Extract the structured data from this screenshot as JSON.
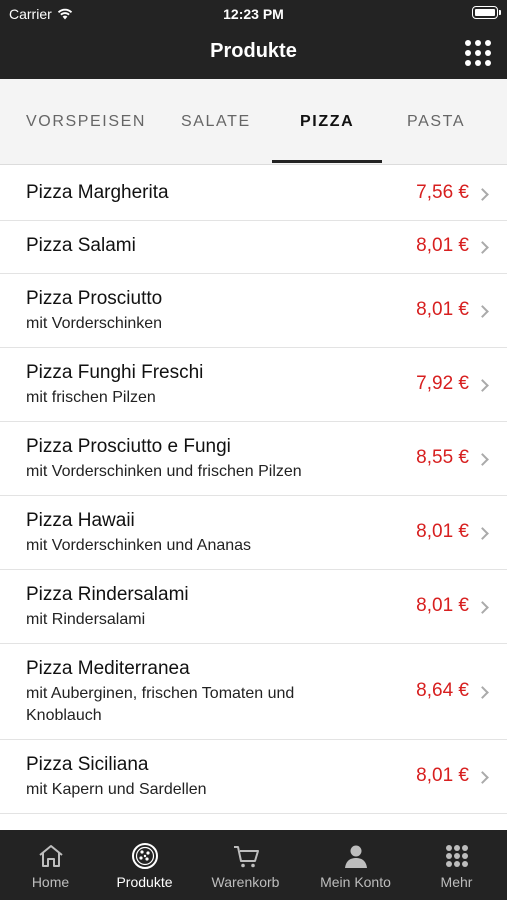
{
  "status_bar": {
    "carrier": "Carrier",
    "time": "12:23 PM"
  },
  "navbar": {
    "title": "Produkte",
    "menu_icon": "grid-menu-icon"
  },
  "category_tabs": [
    {
      "label": "VORSPEISEN",
      "active": false
    },
    {
      "label": "SALATE",
      "active": false
    },
    {
      "label": "PIZZA",
      "active": true
    },
    {
      "label": "PASTA",
      "active": false
    }
  ],
  "products": [
    {
      "name": "Pizza Margherita",
      "description": "",
      "price": "7,56 €"
    },
    {
      "name": "Pizza Salami",
      "description": "",
      "price": "8,01 €"
    },
    {
      "name": "Pizza Prosciutto",
      "description": "mit Vorderschinken",
      "price": "8,01 €"
    },
    {
      "name": "Pizza Funghi Freschi",
      "description": "mit frischen Pilzen",
      "price": "7,92 €"
    },
    {
      "name": "Pizza Prosciutto e Fungi",
      "description": "mit Vorderschinken und frischen Pilzen",
      "price": "8,55 €"
    },
    {
      "name": "Pizza Hawaii",
      "description": "mit Vorderschinken und Ananas",
      "price": "8,01 €"
    },
    {
      "name": "Pizza Rindersalami",
      "description": "mit Rindersalami",
      "price": "8,01 €"
    },
    {
      "name": "Pizza Mediterranea",
      "description": "mit Auberginen, frischen Tomaten und Knoblauch",
      "price": "8,64 €"
    },
    {
      "name": "Pizza Siciliana",
      "description": "mit Kapern und Sardellen",
      "price": "8,01 €"
    }
  ],
  "tabbar": [
    {
      "label": "Home",
      "icon": "home-icon",
      "active": false
    },
    {
      "label": "Produkte",
      "icon": "pizza-icon",
      "active": true
    },
    {
      "label": "Warenkorb",
      "icon": "cart-icon",
      "active": false
    },
    {
      "label": "Mein Konto",
      "icon": "user-icon",
      "active": false
    },
    {
      "label": "Mehr",
      "icon": "more-grid-icon",
      "active": false
    }
  ],
  "colors": {
    "header_bg": "#232323",
    "price": "#d71f1f",
    "tabs_bg": "#f4f4f4"
  }
}
